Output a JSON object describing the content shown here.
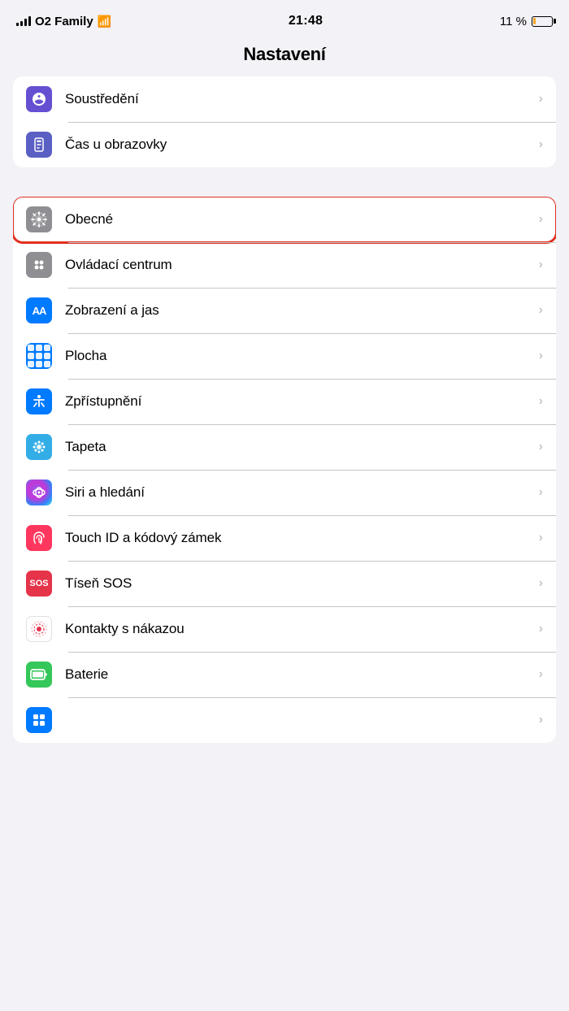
{
  "statusBar": {
    "carrier": "O2 Family",
    "time": "21:48",
    "battery_percent": "11 %"
  },
  "pageTitle": "Nastavení",
  "sections": [
    {
      "id": "top-section",
      "items": [
        {
          "id": "soustredeni",
          "label": "Soustředění",
          "iconType": "moon",
          "iconBg": "purple",
          "highlighted": false
        },
        {
          "id": "cas-u-obrazovky",
          "label": "Čas u obrazovky",
          "iconType": "hourglass",
          "iconBg": "indigo",
          "highlighted": false
        }
      ]
    },
    {
      "id": "main-section",
      "items": [
        {
          "id": "obecne",
          "label": "Obecné",
          "iconType": "gear",
          "iconBg": "gray",
          "highlighted": true
        },
        {
          "id": "ovladaci-centrum",
          "label": "Ovládací centrum",
          "iconType": "control",
          "iconBg": "gray",
          "highlighted": false
        },
        {
          "id": "zobrazeni-jas",
          "label": "Zobrazení a jas",
          "iconType": "aa",
          "iconBg": "blue",
          "highlighted": false
        },
        {
          "id": "plocha",
          "label": "Plocha",
          "iconType": "grid",
          "iconBg": "blue",
          "highlighted": false
        },
        {
          "id": "zpristupneni",
          "label": "Zpřístupnění",
          "iconType": "accessibility",
          "iconBg": "blue",
          "highlighted": false
        },
        {
          "id": "tapeta",
          "label": "Tapeta",
          "iconType": "flower",
          "iconBg": "cyan",
          "highlighted": false
        },
        {
          "id": "siri-hledani",
          "label": "Siri a hledání",
          "iconType": "siri",
          "iconBg": "siri",
          "highlighted": false
        },
        {
          "id": "touch-id",
          "label": "Touch ID a kódový zámek",
          "iconType": "fingerprint",
          "iconBg": "pink",
          "highlighted": false
        },
        {
          "id": "tisen-sos",
          "label": "Tíseň SOS",
          "iconType": "sos",
          "iconBg": "red",
          "highlighted": false
        },
        {
          "id": "kontakty-nakazou",
          "label": "Kontakty s nákazou",
          "iconType": "exposure",
          "iconBg": "white",
          "highlighted": false
        },
        {
          "id": "baterie",
          "label": "Baterie",
          "iconType": "battery",
          "iconBg": "green",
          "highlighted": false
        },
        {
          "id": "partial",
          "label": "",
          "iconType": "partial",
          "iconBg": "blue",
          "highlighted": false
        }
      ]
    }
  ],
  "chevron": "›"
}
